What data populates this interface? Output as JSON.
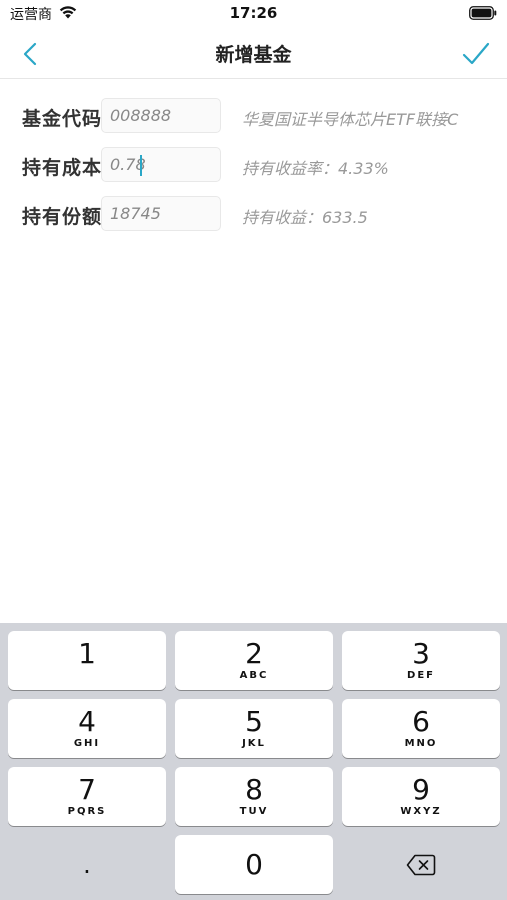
{
  "status_bar": {
    "carrier": "运营商",
    "time": "17:26"
  },
  "nav": {
    "title": "新增基金",
    "accent_color": "#2aa7c7"
  },
  "form": {
    "rows": [
      {
        "label": "基金代码",
        "value": "008888",
        "info": "华夏国证半导体芯片ETF联接C"
      },
      {
        "label": "持有成本",
        "value": "0.78",
        "info": "持有收益率：4.33%"
      },
      {
        "label": "持有份额",
        "value": "18745",
        "info": "持有收益：633.5"
      }
    ]
  },
  "keyboard": {
    "keys": [
      {
        "digit": "1",
        "letters": ""
      },
      {
        "digit": "2",
        "letters": "ABC"
      },
      {
        "digit": "3",
        "letters": "DEF"
      },
      {
        "digit": "4",
        "letters": "GHI"
      },
      {
        "digit": "5",
        "letters": "JKL"
      },
      {
        "digit": "6",
        "letters": "MNO"
      },
      {
        "digit": "7",
        "letters": "PQRS"
      },
      {
        "digit": "8",
        "letters": "TUV"
      },
      {
        "digit": "9",
        "letters": "WXYZ"
      }
    ],
    "decimal": ".",
    "zero": "0"
  }
}
